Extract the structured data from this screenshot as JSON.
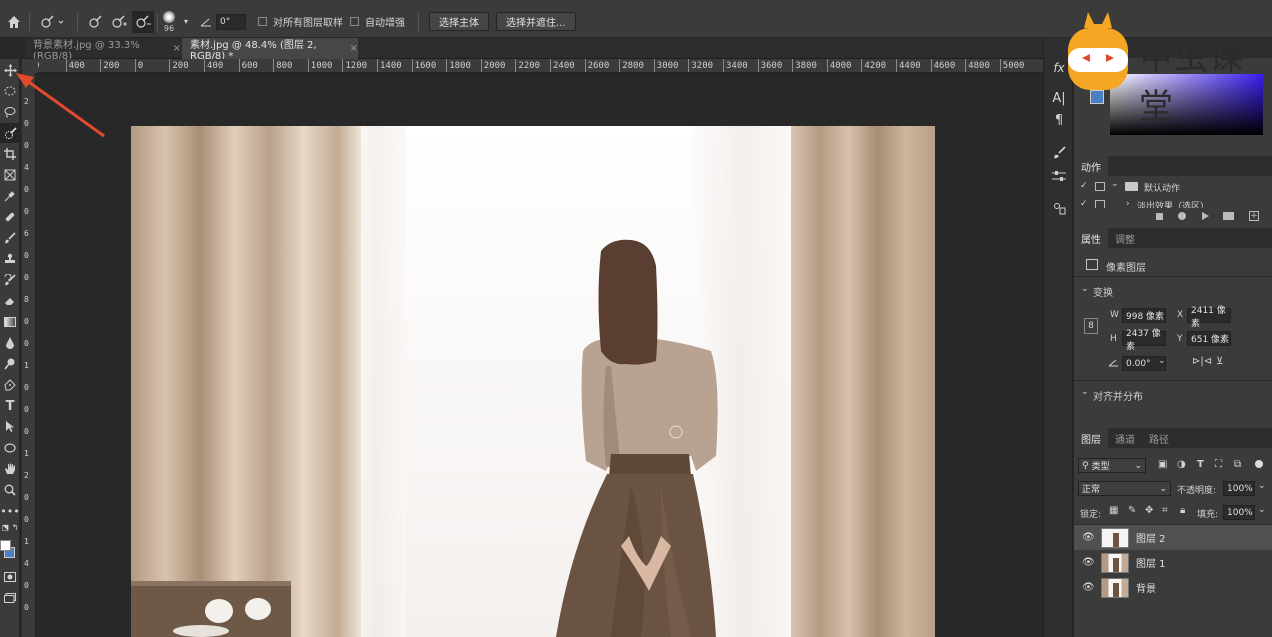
{
  "options": {
    "brush_size": "96",
    "angle": "0°",
    "sample_all_layers": "对所有图层取样",
    "auto_enhance": "自动增强",
    "select_subject": "选择主体",
    "select_and_mask": "选择并遮住..."
  },
  "tabs": [
    {
      "label": "背景素材.jpg @ 33.3%(RGB/8)",
      "close": "×"
    },
    {
      "label": "素材.jpg @ 48.4% (图层 2, RGB/8) *",
      "close": "×"
    }
  ],
  "ruler_h": [
    "0",
    "400",
    "200",
    "0",
    "200",
    "400",
    "600",
    "800",
    "1000",
    "1200",
    "1400",
    "1600",
    "1800",
    "2000",
    "2200",
    "2400",
    "2600",
    "2800",
    "3000",
    "3200",
    "3400",
    "3600",
    "3800",
    "4000",
    "4200",
    "4400",
    "4600",
    "4800",
    "5000"
  ],
  "ruler_v": [
    "0",
    "2",
    "0",
    "0",
    "4",
    "0",
    "0",
    "6",
    "0",
    "0",
    "8",
    "0",
    "0",
    "1",
    "0",
    "0",
    "0",
    "1",
    "2",
    "0",
    "0",
    "1",
    "4",
    "0",
    "0"
  ],
  "panels": {
    "actions_tab": "动作",
    "actions": [
      {
        "label": "默认动作"
      },
      {
        "label": "淡出效果（选区）"
      }
    ],
    "properties_tabs": [
      "属性",
      "调整"
    ],
    "layer_type": "像素图层",
    "transform": "变换",
    "w_label": "W",
    "w_value": "998 像素",
    "x_label": "X",
    "x_value": "2411 像素",
    "h_label": "H",
    "h_value": "2437 像素",
    "y_label": "Y",
    "y_value": "651 像素",
    "angle_value": "0.00°",
    "align": "对齐并分布",
    "layers_tabs": [
      "图层",
      "通道",
      "路径"
    ],
    "filter_kind": "类型",
    "blend_mode": "正常",
    "opacity_label": "不透明度:",
    "opacity_value": "100%",
    "lock_label": "锁定:",
    "fill_label": "填充:",
    "fill_value": "100%",
    "layers": [
      {
        "name": "图层 2"
      },
      {
        "name": "图层 1"
      },
      {
        "name": "背景"
      }
    ]
  },
  "watermark": {
    "text": "甲虫课堂"
  },
  "colors": {
    "accent": "#e24a2d",
    "brand": "#f5a623"
  }
}
